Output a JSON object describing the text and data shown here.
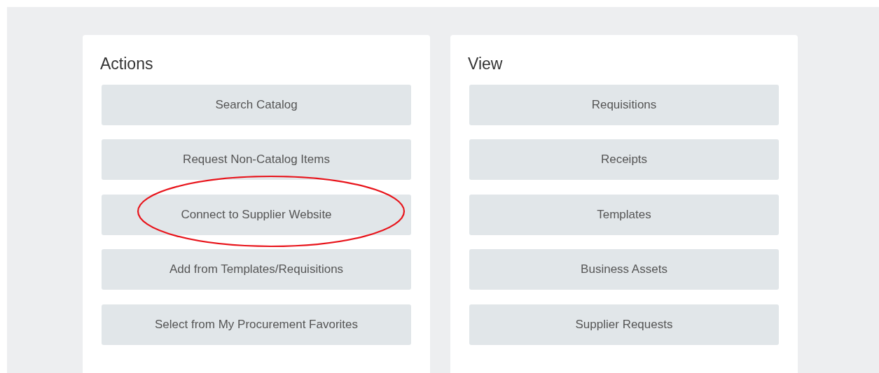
{
  "panels": [
    {
      "title": "Actions",
      "items": [
        {
          "label": "Search Catalog",
          "circled": false
        },
        {
          "label": "Request Non-Catalog Items",
          "circled": false
        },
        {
          "label": "Connect to Supplier Website",
          "circled": true
        },
        {
          "label": "Add from Templates/Requisitions",
          "circled": false
        },
        {
          "label": "Select from My Procurement Favorites",
          "circled": false
        }
      ]
    },
    {
      "title": "View",
      "items": [
        {
          "label": "Requisitions",
          "circled": false
        },
        {
          "label": "Receipts",
          "circled": false
        },
        {
          "label": "Templates",
          "circled": false
        },
        {
          "label": "Business Assets",
          "circled": false
        },
        {
          "label": "Supplier Requests",
          "circled": false
        }
      ]
    }
  ]
}
